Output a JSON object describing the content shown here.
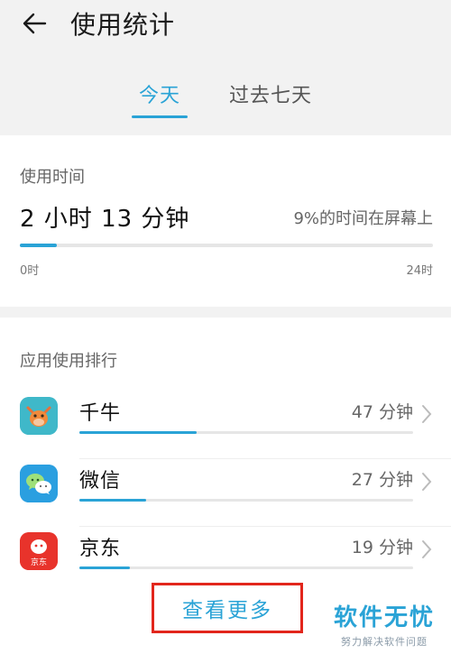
{
  "header": {
    "title": "使用统计",
    "tabs": [
      {
        "label": "今天",
        "active": true
      },
      {
        "label": "过去七天",
        "active": false
      }
    ]
  },
  "usage": {
    "section_label": "使用时间",
    "total": "2 小时 13 分钟",
    "percent_text": "9%的时间在屏幕上",
    "progress_fraction": 0.09,
    "axis_start": "0时",
    "axis_end": "24时"
  },
  "ranking": {
    "section_label": "应用使用排行",
    "apps": [
      {
        "name": "千牛",
        "time": "47 分钟",
        "icon": "qianniu-icon",
        "bar_fraction": 0.35
      },
      {
        "name": "微信",
        "time": "27 分钟",
        "icon": "wechat-icon",
        "bar_fraction": 0.2
      },
      {
        "name": "京东",
        "time": "19 分钟",
        "icon": "jd-icon",
        "bar_fraction": 0.15,
        "icon_text": "京东"
      }
    ],
    "see_more_label": "查看更多"
  },
  "watermark": {
    "main": "软件无忧",
    "sub": "努力解决软件问题"
  },
  "colors": {
    "accent": "#2aa3d6",
    "highlight_border": "#e2261c"
  }
}
